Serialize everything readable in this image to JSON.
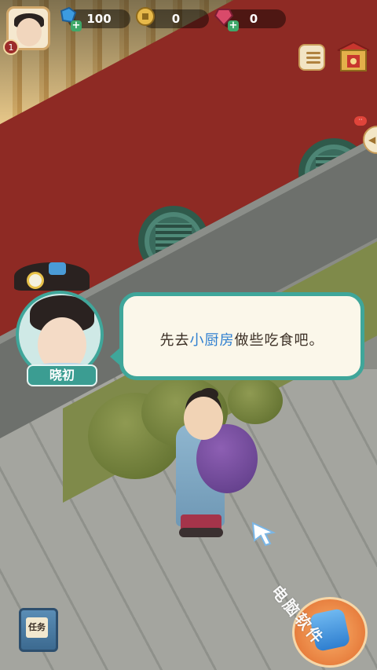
{
  "top_bar": {
    "level": "1",
    "resources": [
      {
        "name": "jade",
        "value": "100",
        "icon": "blue-jade-icon"
      },
      {
        "name": "coin",
        "value": "0",
        "icon": "copper-coin-icon"
      },
      {
        "name": "gem",
        "value": "0",
        "icon": "red-gem-icon"
      }
    ]
  },
  "dialog": {
    "speaker": "晓初",
    "text_before": "先去",
    "text_highlight": "小厨房",
    "text_after": "做些吃食吧。"
  },
  "bottom": {
    "task_label": "任务"
  },
  "watermark": "电脑软件",
  "colors": {
    "dialog_border": "#3fa69a",
    "highlight": "#2f7fd0",
    "wall_red": "#8e2a24",
    "accent_gold": "#c89b57"
  }
}
